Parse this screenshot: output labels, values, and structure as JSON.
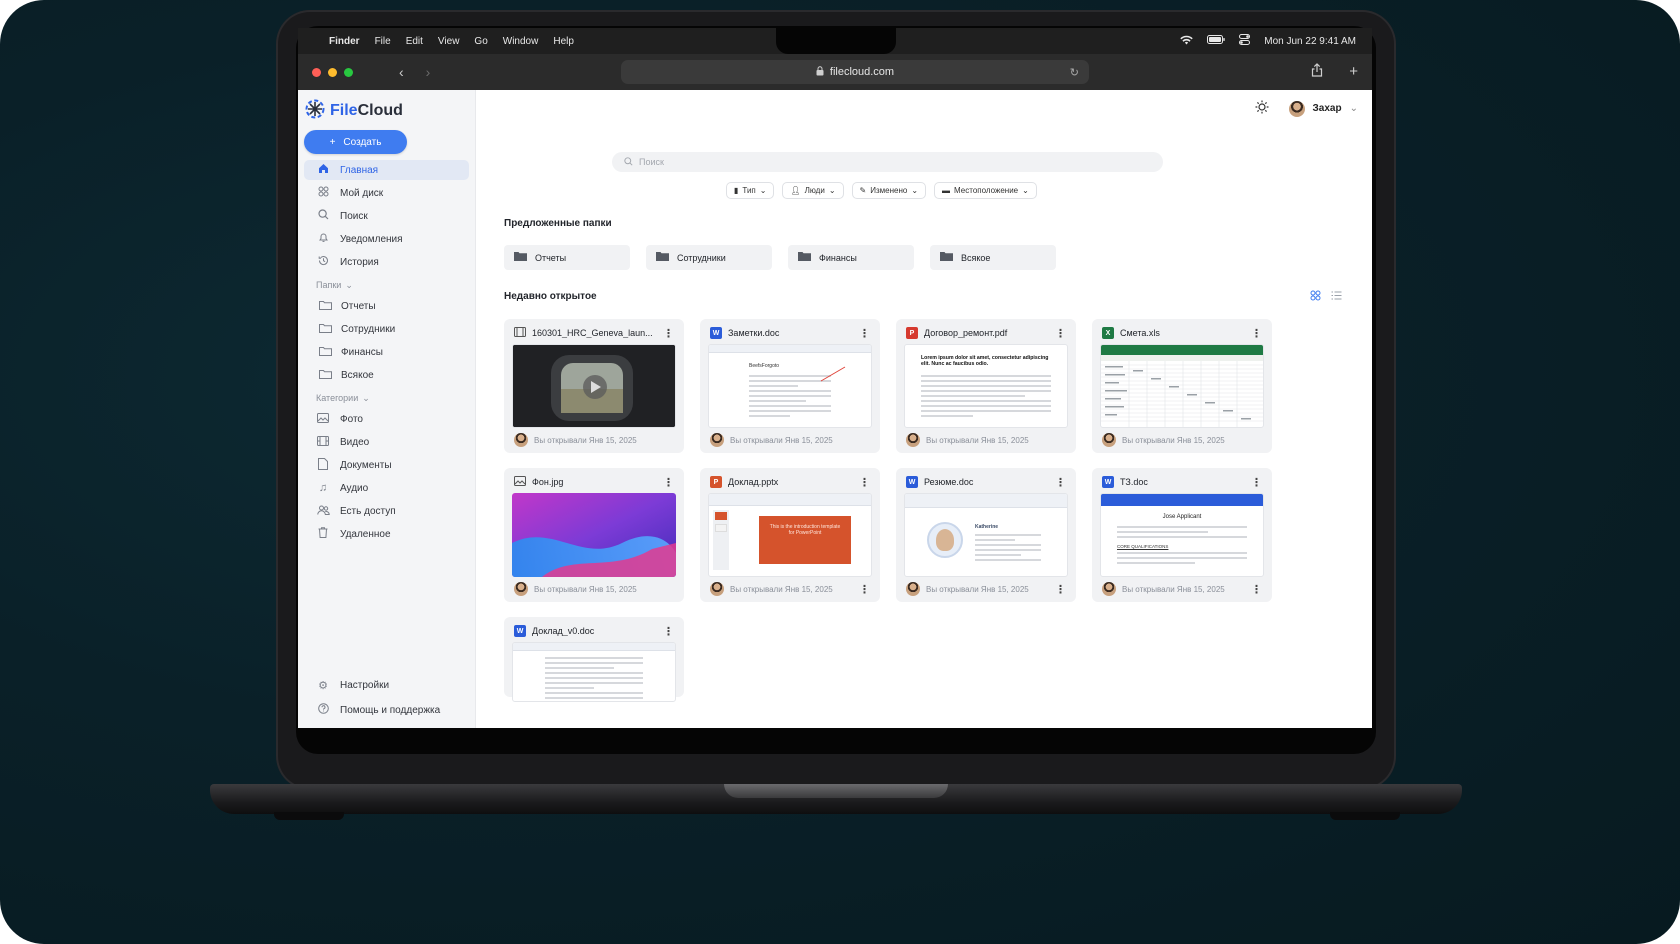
{
  "menubar": {
    "app": "Finder",
    "items": [
      "File",
      "Edit",
      "View",
      "Go",
      "Window",
      "Help"
    ],
    "datetime": "Mon Jun 22  9:41 AM"
  },
  "browser": {
    "url": "filecloud.com"
  },
  "app": {
    "brand_a": "File",
    "brand_b": "Cloud",
    "create_label": "Создать",
    "user_name": "Захар"
  },
  "sidebar": {
    "nav": [
      "Главная",
      "Мой диск",
      "Поиск",
      "Уведомления",
      "История"
    ],
    "folders_title": "Папки",
    "folders": [
      "Отчеты",
      "Сотрудники",
      "Финансы",
      "Всякое"
    ],
    "categories_title": "Категории",
    "categories": [
      "Фото",
      "Видео",
      "Документы",
      "Аудио",
      "Есть доступ",
      "Удаленное"
    ],
    "settings": "Настройки",
    "help": "Помощь и поддержка"
  },
  "main": {
    "search_placeholder": "Поиск",
    "filters": [
      "Тип",
      "Люди",
      "Изменено",
      "Местоположение"
    ],
    "suggested_title": "Предложенные папки",
    "suggested": [
      "Отчеты",
      "Сотрудники",
      "Финансы",
      "Всякое"
    ],
    "recent_title": "Недавно открытое",
    "files": [
      {
        "name": "160301_HRC_Geneva_laun...",
        "meta": "Вы открывали Янв 15, 2025"
      },
      {
        "name": "Заметки.doc",
        "meta": "Вы открывали Янв 15, 2025"
      },
      {
        "name": "Договор_ремонт.pdf",
        "meta": "Вы открывали Янв 15, 2025"
      },
      {
        "name": "Смета.xls",
        "meta": "Вы открывали Янв 15, 2025"
      },
      {
        "name": "Фон.jpg",
        "meta": "Вы открывали Янв 15, 2025"
      },
      {
        "name": "Доклад.pptx",
        "meta": "Вы открывали Янв 15, 2025"
      },
      {
        "name": "Резюме.doc",
        "meta": "Вы открывали Янв 15, 2025"
      },
      {
        "name": "ТЗ.doc",
        "meta": "Вы открывали Янв 15, 2025"
      },
      {
        "name": "Доклад_v0.doc",
        "meta": ""
      }
    ],
    "thumb_text": {
      "notes_title": "BeefsForgoto",
      "pdf_heading": "Lorem ipsum dolor sit amet, consectetur adipiscing elit. Nunc ac faucibus odio.",
      "pptx_slide": "This is the introduction template for PowerPoint",
      "resume_name": "Katherine",
      "spec_name": "Jose Applicant",
      "spec_section": "CORE QUALIFICATIONS"
    }
  },
  "colors": {
    "accent": "#3f7cf0",
    "word": "#2b5cd9",
    "excel": "#1f7a44",
    "pdf": "#d63a2f",
    "ppt": "#d5532c"
  }
}
